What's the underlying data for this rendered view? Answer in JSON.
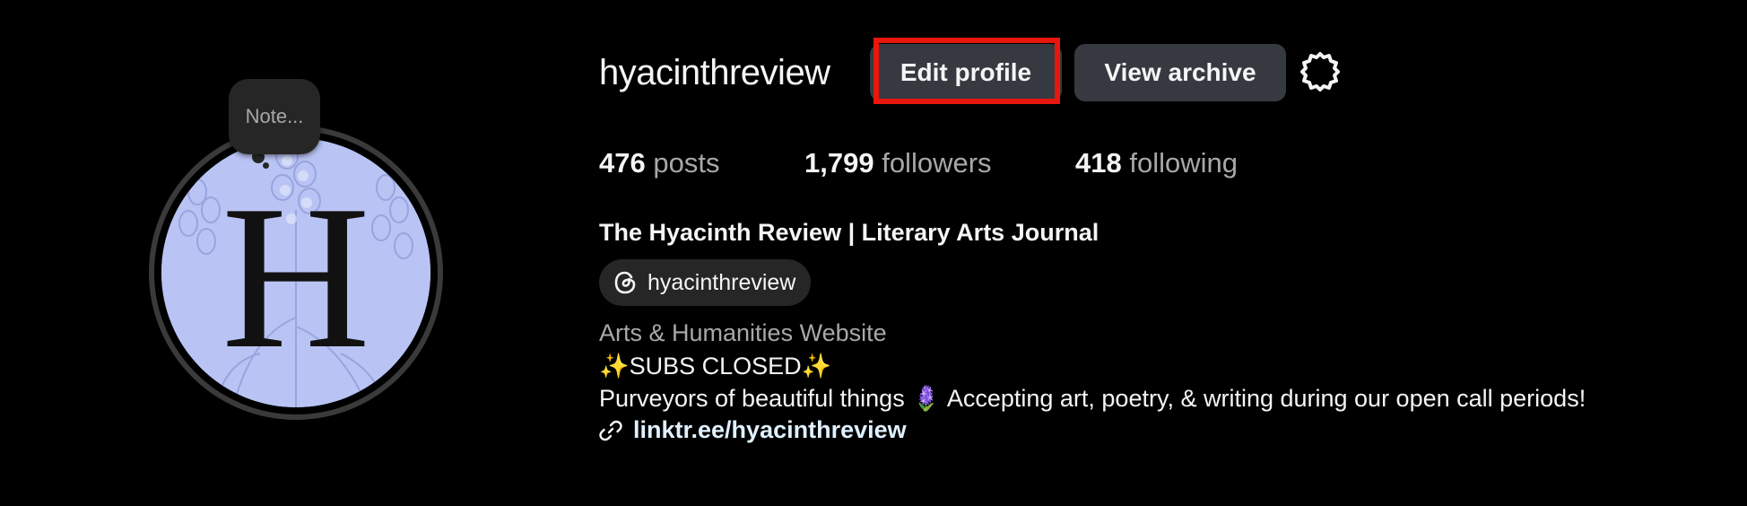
{
  "profile": {
    "username": "hyacinthreview",
    "note": "Note...",
    "avatar_letter": "H"
  },
  "buttons": {
    "edit_profile": "Edit profile",
    "view_archive": "View archive"
  },
  "stats": {
    "posts_count": "476",
    "posts_label": "posts",
    "followers_count": "1,799",
    "followers_label": "followers",
    "following_count": "418",
    "following_label": "following"
  },
  "bio": {
    "full_name": "The Hyacinth Review | Literary Arts Journal",
    "threads_handle": "hyacinthreview",
    "category": "Arts & Humanities Website",
    "line1": "✨SUBS CLOSED✨",
    "line2": "Purveyors of beautiful things 🪻 Accepting art, poetry, & writing during our open call periods!",
    "link": "linktr.ee/hyacinthreview"
  },
  "colors": {
    "background": "#000000",
    "button_bg": "#363a40",
    "highlight": "#e8160c",
    "avatar_bg": "#b8c3f3",
    "link": "#e0f1ff"
  },
  "icons": {
    "settings": "gear-icon",
    "threads": "threads-icon",
    "link": "link-icon"
  }
}
